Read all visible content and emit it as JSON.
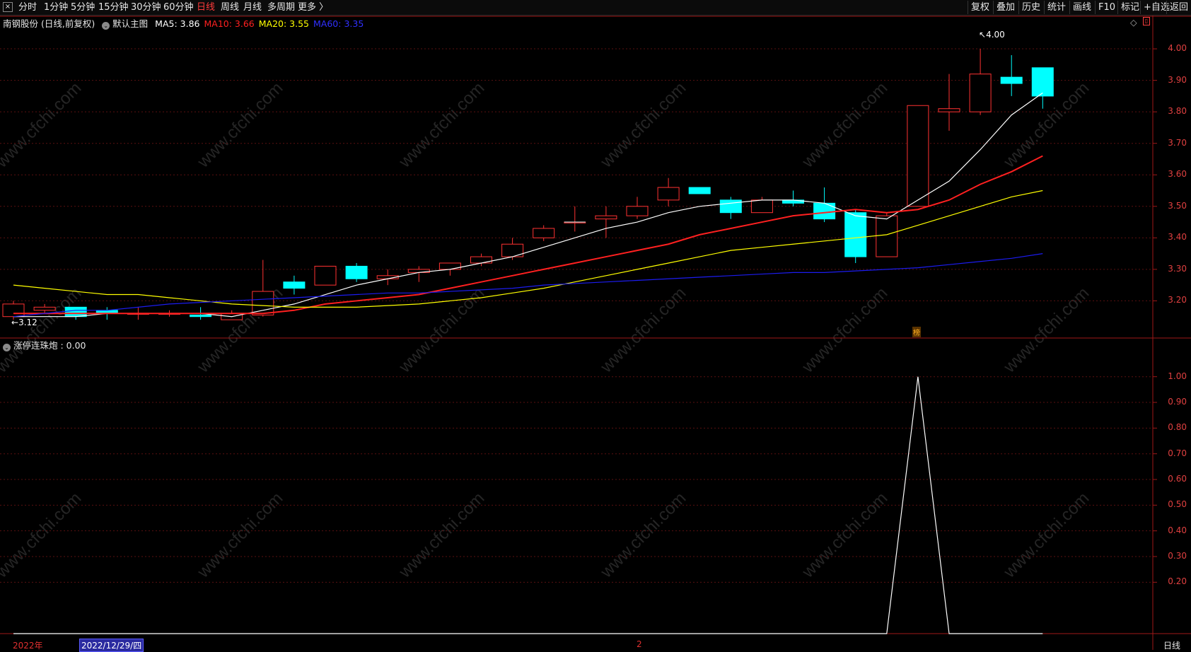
{
  "toolbar": {
    "periods": [
      "分时",
      "1分钟",
      "5分钟",
      "15分钟",
      "30分钟",
      "60分钟",
      "日线",
      "周线",
      "月线",
      "多周期",
      "更多 〉"
    ],
    "active_period": "日线",
    "right_buttons": [
      "复权",
      "叠加",
      "历史",
      "统计",
      "画线",
      "F10",
      "标记",
      "+自选",
      "返回"
    ]
  },
  "main_chart": {
    "title": "南钢股份 (日线,前复权)",
    "template": "默认主图",
    "ma_labels": [
      {
        "text": "MA5: 3.86",
        "color": "#ffffff"
      },
      {
        "text": "MA10: 3.66",
        "color": "#ff2020"
      },
      {
        "text": "MA20: 3.55",
        "color": "#ffff00"
      },
      {
        "text": "MA60: 3.35",
        "color": "#3030ff"
      }
    ],
    "high_marker": "4.00",
    "low_marker": "3.12",
    "event_badge": "榜",
    "y_ticks": [
      "4.00",
      "3.90",
      "3.80",
      "3.70",
      "3.60",
      "3.50",
      "3.40",
      "3.30",
      "3.20"
    ]
  },
  "indicator": {
    "title": "涨停连珠炮 : 0.00",
    "y_ticks": [
      "1.00",
      "0.90",
      "0.80",
      "0.70",
      "0.60",
      "0.50",
      "0.40",
      "0.30",
      "0.20"
    ]
  },
  "bottom_bar": {
    "year_label": "2022年",
    "cursor_date": "2022/12/29/四",
    "month_mark": "2",
    "period_label": "日线"
  },
  "chart_data": {
    "type": "candlestick",
    "price_range": [
      3.1,
      4.02
    ],
    "candles": [
      {
        "o": 3.15,
        "h": 3.2,
        "l": 3.14,
        "c": 3.19
      },
      {
        "o": 3.17,
        "h": 3.19,
        "l": 3.16,
        "c": 3.18
      },
      {
        "o": 3.18,
        "h": 3.18,
        "l": 3.14,
        "c": 3.15
      },
      {
        "o": 3.17,
        "h": 3.18,
        "l": 3.14,
        "c": 3.16
      },
      {
        "o": 3.16,
        "h": 3.18,
        "l": 3.14,
        "c": 3.16
      },
      {
        "o": 3.16,
        "h": 3.17,
        "l": 3.15,
        "c": 3.16
      },
      {
        "o": 3.155,
        "h": 3.18,
        "l": 3.14,
        "c": 3.15
      },
      {
        "o": 3.14,
        "h": 3.17,
        "l": 3.14,
        "c": 3.16
      },
      {
        "o": 3.155,
        "h": 3.33,
        "l": 3.15,
        "c": 3.23
      },
      {
        "o": 3.26,
        "h": 3.28,
        "l": 3.22,
        "c": 3.24
      },
      {
        "o": 3.25,
        "h": 3.31,
        "l": 3.25,
        "c": 3.31
      },
      {
        "o": 3.31,
        "h": 3.32,
        "l": 3.26,
        "c": 3.27
      },
      {
        "o": 3.27,
        "h": 3.3,
        "l": 3.25,
        "c": 3.28
      },
      {
        "o": 3.29,
        "h": 3.31,
        "l": 3.26,
        "c": 3.3
      },
      {
        "o": 3.3,
        "h": 3.32,
        "l": 3.28,
        "c": 3.32
      },
      {
        "o": 3.32,
        "h": 3.35,
        "l": 3.31,
        "c": 3.34
      },
      {
        "o": 3.34,
        "h": 3.4,
        "l": 3.33,
        "c": 3.38
      },
      {
        "o": 3.4,
        "h": 3.44,
        "l": 3.39,
        "c": 3.43
      },
      {
        "o": 3.45,
        "h": 3.5,
        "l": 3.42,
        "c": 3.45
      },
      {
        "o": 3.46,
        "h": 3.5,
        "l": 3.4,
        "c": 3.47
      },
      {
        "o": 3.47,
        "h": 3.53,
        "l": 3.46,
        "c": 3.5
      },
      {
        "o": 3.52,
        "h": 3.59,
        "l": 3.5,
        "c": 3.56
      },
      {
        "o": 3.56,
        "h": 3.56,
        "l": 3.54,
        "c": 3.54
      },
      {
        "o": 3.52,
        "h": 3.53,
        "l": 3.46,
        "c": 3.48
      },
      {
        "o": 3.48,
        "h": 3.53,
        "l": 3.48,
        "c": 3.52
      },
      {
        "o": 3.52,
        "h": 3.55,
        "l": 3.5,
        "c": 3.51
      },
      {
        "o": 3.51,
        "h": 3.56,
        "l": 3.45,
        "c": 3.46
      },
      {
        "o": 3.48,
        "h": 3.49,
        "l": 3.32,
        "c": 3.34
      },
      {
        "o": 3.34,
        "h": 3.48,
        "l": 3.34,
        "c": 3.47
      },
      {
        "o": 3.5,
        "h": 3.82,
        "l": 3.5,
        "c": 3.82
      },
      {
        "o": 3.8,
        "h": 3.92,
        "l": 3.74,
        "c": 3.81
      },
      {
        "o": 3.8,
        "h": 4.0,
        "l": 3.79,
        "c": 3.92
      },
      {
        "o": 3.91,
        "h": 3.98,
        "l": 3.85,
        "c": 3.89
      },
      {
        "o": 3.94,
        "h": 3.94,
        "l": 3.81,
        "c": 3.85
      }
    ],
    "ma_series": [
      {
        "name": "MA5",
        "color": "#ffffff",
        "values": [
          3.15,
          3.15,
          3.15,
          3.16,
          3.16,
          3.16,
          3.16,
          3.15,
          3.17,
          3.19,
          3.22,
          3.25,
          3.27,
          3.29,
          3.3,
          3.32,
          3.34,
          3.37,
          3.4,
          3.43,
          3.45,
          3.48,
          3.5,
          3.51,
          3.52,
          3.52,
          3.51,
          3.47,
          3.46,
          3.52,
          3.58,
          3.68,
          3.79,
          3.86
        ]
      },
      {
        "name": "MA10",
        "color": "#ff2020",
        "values": [
          3.16,
          3.16,
          3.16,
          3.16,
          3.16,
          3.16,
          3.16,
          3.16,
          3.16,
          3.17,
          3.19,
          3.2,
          3.21,
          3.22,
          3.24,
          3.26,
          3.28,
          3.3,
          3.32,
          3.34,
          3.36,
          3.38,
          3.41,
          3.43,
          3.45,
          3.47,
          3.48,
          3.49,
          3.48,
          3.49,
          3.52,
          3.57,
          3.61,
          3.66
        ]
      },
      {
        "name": "MA20",
        "color": "#ffff00",
        "values": [
          3.25,
          3.24,
          3.23,
          3.22,
          3.22,
          3.21,
          3.2,
          3.19,
          3.185,
          3.18,
          3.18,
          3.18,
          3.185,
          3.19,
          3.2,
          3.21,
          3.225,
          3.24,
          3.26,
          3.28,
          3.3,
          3.32,
          3.34,
          3.36,
          3.37,
          3.38,
          3.39,
          3.4,
          3.41,
          3.44,
          3.47,
          3.5,
          3.53,
          3.55
        ]
      },
      {
        "name": "MA60",
        "color": "#1c1cf0",
        "values": [
          3.15,
          3.16,
          3.17,
          3.17,
          3.18,
          3.19,
          3.195,
          3.2,
          3.205,
          3.21,
          3.215,
          3.22,
          3.225,
          3.225,
          3.23,
          3.235,
          3.24,
          3.25,
          3.255,
          3.26,
          3.265,
          3.27,
          3.275,
          3.28,
          3.285,
          3.29,
          3.29,
          3.295,
          3.3,
          3.305,
          3.315,
          3.325,
          3.335,
          3.35
        ]
      }
    ],
    "indicator_values": [
      0,
      0,
      0,
      0,
      0,
      0,
      0,
      0,
      0,
      0,
      0,
      0,
      0,
      0,
      0,
      0,
      0,
      0,
      0,
      0,
      0,
      0,
      0,
      0,
      0,
      0,
      0,
      0,
      0,
      1,
      0,
      0,
      0,
      0
    ],
    "indicator_range": [
      0,
      1.05
    ]
  }
}
